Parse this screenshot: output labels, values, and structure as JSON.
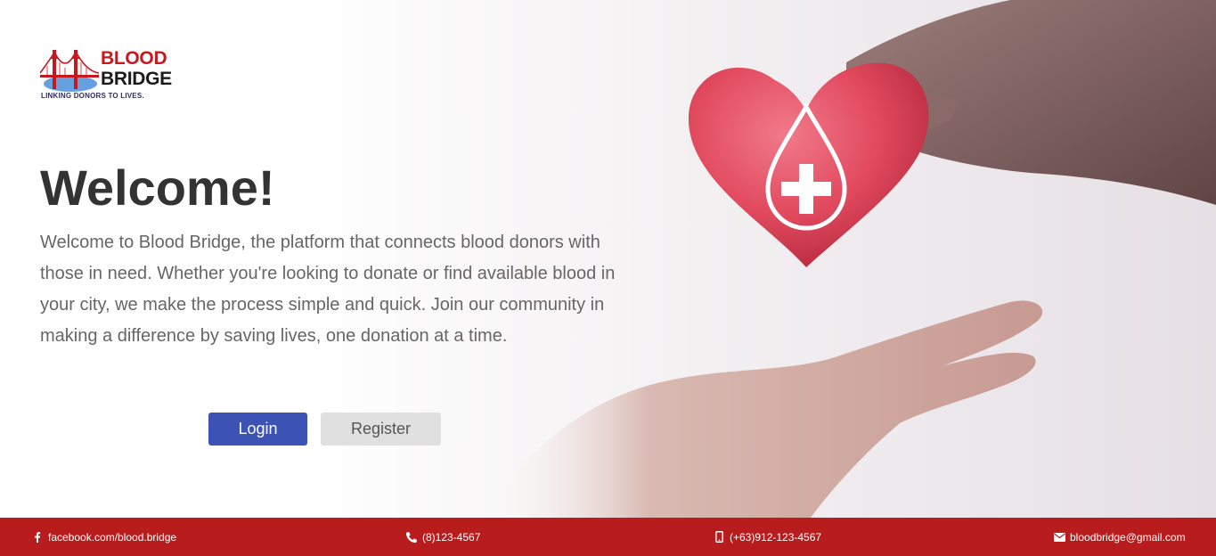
{
  "logo": {
    "word1": "BLOOD",
    "word2": "BRIDGE",
    "tagline": "LINKING DONORS TO LIVES."
  },
  "hero": {
    "title": "Welcome!",
    "description": "Welcome to Blood Bridge, the platform that connects blood donors with those in need. Whether you're looking to donate or find available blood in your city, we make the process simple and quick. Join our community in making a difference by saving lives, one donation at a time."
  },
  "buttons": {
    "login": "Login",
    "register": "Register"
  },
  "footer": {
    "facebook": "facebook.com/blood.bridge",
    "phone": "(8)123-4567",
    "mobile": "(+63)912-123-4567",
    "email": "bloodbridge@gmail.com"
  },
  "colors": {
    "brand_red": "#b81c1d",
    "login_blue": "#3d52b5",
    "register_gray": "#e0e0e0",
    "title_text": "#333333",
    "body_text": "#666666"
  },
  "icons": {
    "facebook": "facebook-icon",
    "phone": "phone-icon",
    "mobile": "mobile-icon",
    "email": "envelope-icon"
  }
}
